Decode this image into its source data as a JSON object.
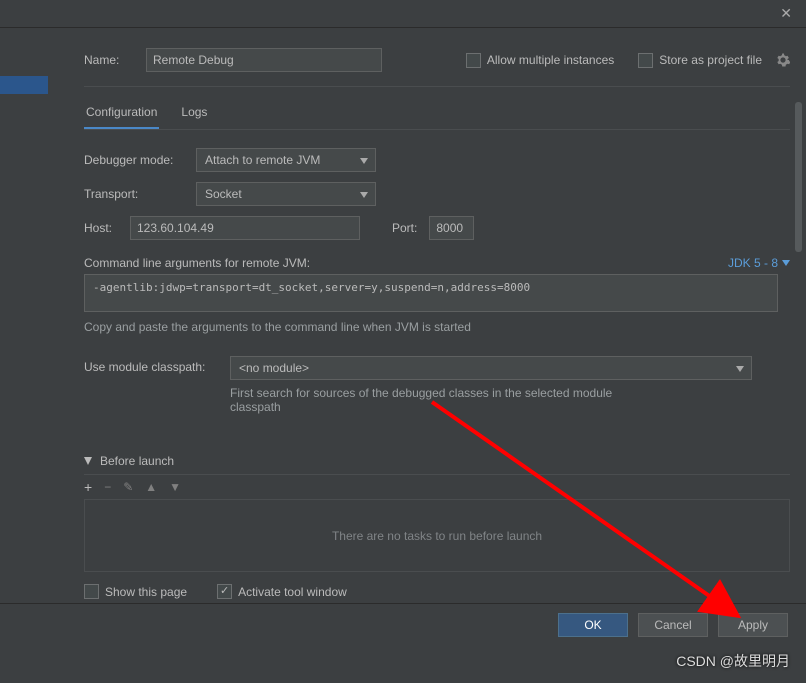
{
  "nameLabel": "Name:",
  "nameValue": "Remote Debug",
  "allowMultiple": "Allow multiple instances",
  "storeAsProject": "Store as project file",
  "tabs": {
    "config": "Configuration",
    "logs": "Logs"
  },
  "debuggerModeLabel": "Debugger mode:",
  "debuggerModeValue": "Attach to remote JVM",
  "transportLabel": "Transport:",
  "transportValue": "Socket",
  "hostLabel": "Host:",
  "hostValue": "123.60.104.49",
  "portLabel": "Port:",
  "portValue": "8000",
  "cmdLabel": "Command line arguments for remote JVM:",
  "jdkLabel": "JDK 5 - 8",
  "cmdValue": "-agentlib:jdwp=transport=dt_socket,server=y,suspend=n,address=8000",
  "cmdHint": "Copy and paste the arguments to the command line when JVM is started",
  "moduleLabel": "Use module classpath:",
  "moduleValue": "<no module>",
  "moduleHint": "First search for sources of the debugged classes in the selected module classpath",
  "beforeLaunch": "Before launch",
  "noTasks": "There are no tasks to run before launch",
  "showThisPage": "Show this page",
  "activateTool": "Activate tool window",
  "buttons": {
    "ok": "OK",
    "cancel": "Cancel",
    "apply": "Apply"
  },
  "watermark": "CSDN @故里明月"
}
